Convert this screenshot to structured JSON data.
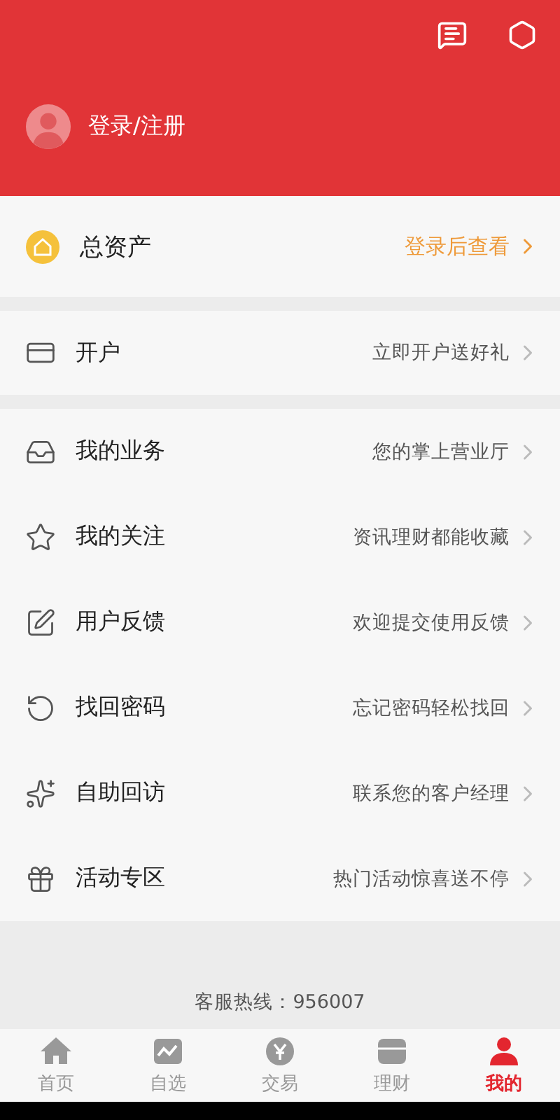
{
  "header": {
    "login_label": "登录/注册"
  },
  "assets": {
    "label": "总资产",
    "action": "登录后查看"
  },
  "open_account": {
    "label": "开户",
    "hint": "立即开户送好礼"
  },
  "menu": [
    {
      "label": "我的业务",
      "hint": "您的掌上营业厅"
    },
    {
      "label": "我的关注",
      "hint": "资讯理财都能收藏"
    },
    {
      "label": "用户反馈",
      "hint": "欢迎提交使用反馈"
    },
    {
      "label": "找回密码",
      "hint": "忘记密码轻松找回"
    },
    {
      "label": "自助回访",
      "hint": "联系您的客户经理"
    },
    {
      "label": "活动专区",
      "hint": "热门活动惊喜送不停"
    }
  ],
  "hotline": "客服热线：956007",
  "tabs": [
    {
      "label": "首页",
      "selected": false
    },
    {
      "label": "自选",
      "selected": false
    },
    {
      "label": "交易",
      "selected": false
    },
    {
      "label": "理财",
      "selected": false
    },
    {
      "label": "我的",
      "selected": true
    }
  ]
}
